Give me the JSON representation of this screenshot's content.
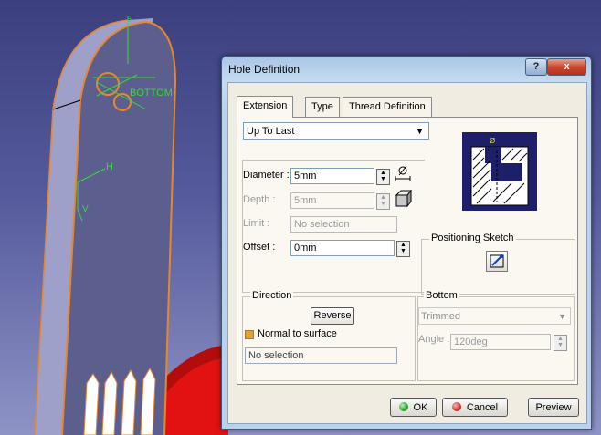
{
  "dialog": {
    "title": "Hole Definition",
    "help_label": "?",
    "close_label": "x"
  },
  "tabs": [
    {
      "label": "Extension",
      "active": true
    },
    {
      "label": "Type",
      "active": false
    },
    {
      "label": "Thread Definition",
      "active": false
    }
  ],
  "extension": {
    "limit_type": "Up To Last",
    "diameter": {
      "label": "Diameter :",
      "value": "5mm"
    },
    "depth": {
      "label": "Depth :",
      "value": "5mm",
      "enabled": false
    },
    "limit": {
      "label": "Limit :",
      "value": "No selection",
      "enabled": false
    },
    "offset": {
      "label": "Offset :",
      "value": "0mm"
    }
  },
  "positioning_sketch": {
    "title": "Positioning Sketch"
  },
  "direction": {
    "title": "Direction",
    "reverse_label": "Reverse",
    "normal_to_surface": {
      "label": "Normal to surface",
      "checked": true
    },
    "selection_value": "No selection"
  },
  "bottom": {
    "title": "Bottom",
    "type": "Trimmed",
    "angle": {
      "label": "Angle :",
      "value": "120deg"
    }
  },
  "buttons": {
    "ok": "OK",
    "cancel": "Cancel",
    "preview": "Preview"
  },
  "viewport": {
    "labels": {
      "bottom": "BOTTOM",
      "h": "H",
      "v": "V",
      "dim": "5"
    }
  },
  "colors": {
    "background_top": "#3b3f7e",
    "part_fill": "#5c5e8e",
    "part_edge": "#e8872a",
    "sketch_green": "#38d83a",
    "red_part": "#e21212",
    "ok_green": "#2fa52f",
    "cancel_red": "#d7332b"
  }
}
